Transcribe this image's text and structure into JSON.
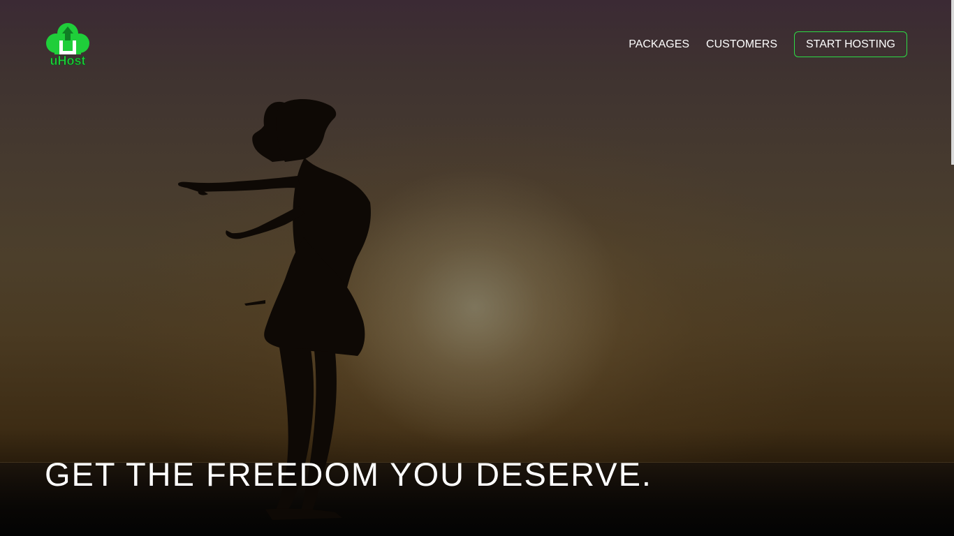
{
  "brand": {
    "name": "uHost",
    "accent_color": "#2ddc45"
  },
  "nav": {
    "links": [
      {
        "label": "PACKAGES"
      },
      {
        "label": "CUSTOMERS"
      }
    ],
    "cta_label": "START HOSTING"
  },
  "hero": {
    "headline": "GET THE FREEDOM YOU DESERVE.",
    "background_image": "silhouette-woman-sunset-beach"
  }
}
